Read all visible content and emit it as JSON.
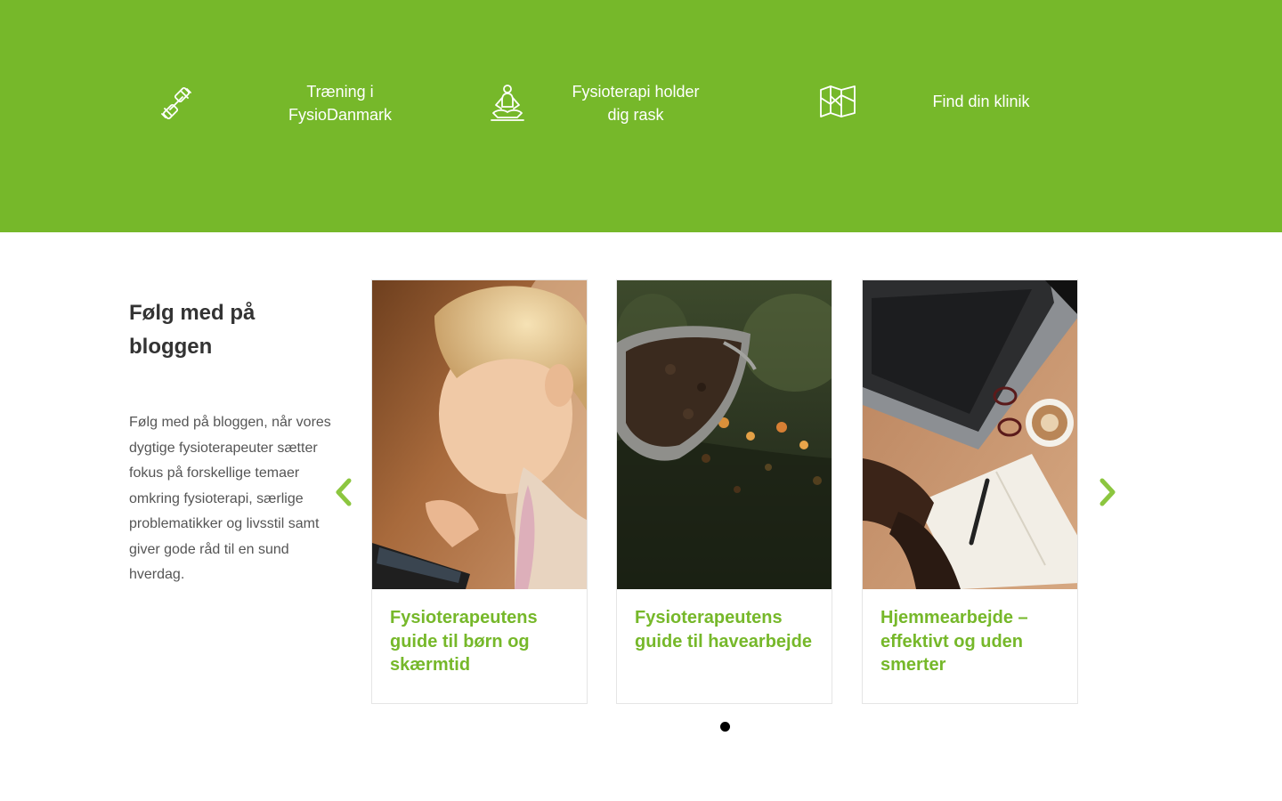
{
  "hero": {
    "items": [
      {
        "label": "Træning i FysioDanmark",
        "icon": "dumbbell-icon"
      },
      {
        "label": "Fysioterapi holder dig rask",
        "icon": "meditation-icon"
      },
      {
        "label": "Find din klinik",
        "icon": "map-icon"
      }
    ]
  },
  "blog": {
    "title": "Følg med på bloggen",
    "text": "Følg med på bloggen, når vores dygtige fysioterapeuter sætter fokus på forskellige temaer omkring fysioterapi, særlige problematikker og livsstil samt giver gode råd til en sund hverdag.",
    "cards": [
      {
        "title": "Fysioterapeutens guide til børn og skærmtid"
      },
      {
        "title": "Fysioterapeutens guide til havearbejde"
      },
      {
        "title": "Hjemmearbejde – effektivt og uden smerter"
      }
    ]
  },
  "carousel": {
    "prev_icon": "chevron-left-icon",
    "next_icon": "chevron-right-icon",
    "active_page": 1,
    "total_pages": 1
  },
  "colors": {
    "brand_green": "#76b82a",
    "heading": "#333333",
    "body_text": "#555555"
  }
}
